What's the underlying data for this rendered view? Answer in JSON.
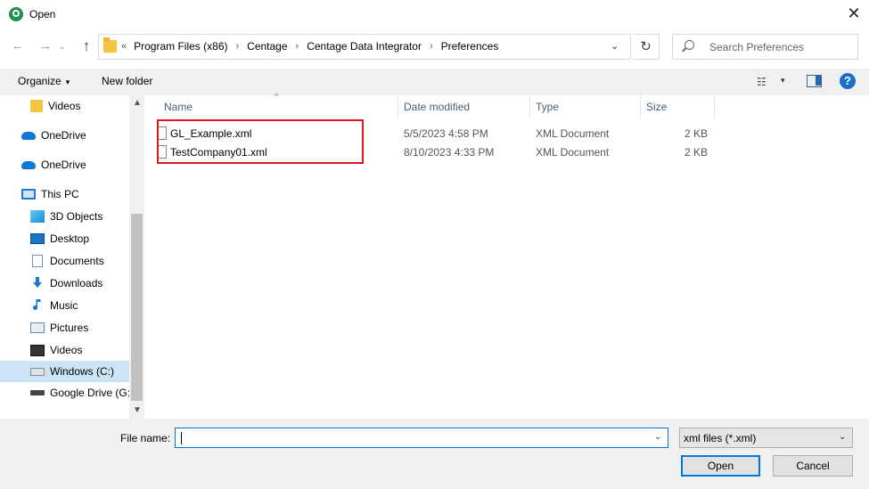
{
  "window": {
    "title": "Open",
    "close_glyph": "✕"
  },
  "nav": {
    "back_glyph": "←",
    "forward_glyph": "→",
    "recent_glyph": "⌄",
    "up_glyph": "↑"
  },
  "address": {
    "prefix": "«",
    "crumbs": [
      "Program Files (x86)",
      "Centage",
      "Centage Data Integrator",
      "Preferences"
    ],
    "separator": "›",
    "dropdown_glyph": "⌄",
    "refresh_glyph": "↻"
  },
  "search": {
    "placeholder": "Search Preferences"
  },
  "toolbar": {
    "organize_label": "Organize",
    "organize_caret": "▾",
    "new_folder_label": "New folder",
    "view_glyph": "☷",
    "view_caret": "▾",
    "help_glyph": "?"
  },
  "sidebar": {
    "scroll_up_glyph": "▲",
    "scroll_down_glyph": "▼",
    "items": [
      {
        "label": "Videos",
        "icon": "folder-icon"
      },
      {
        "label": "OneDrive",
        "icon": "onedrive-icon"
      },
      {
        "label": "OneDrive",
        "icon": "onedrive-icon"
      },
      {
        "label": "This PC",
        "icon": "pc-icon"
      },
      {
        "label": "3D Objects",
        "icon": "3d-objects-icon"
      },
      {
        "label": "Desktop",
        "icon": "desktop-icon"
      },
      {
        "label": "Documents",
        "icon": "documents-icon"
      },
      {
        "label": "Downloads",
        "icon": "downloads-icon"
      },
      {
        "label": "Music",
        "icon": "music-icon"
      },
      {
        "label": "Pictures",
        "icon": "pictures-icon"
      },
      {
        "label": "Videos",
        "icon": "videos-icon"
      },
      {
        "label": "Windows (C:)",
        "icon": "drive-icon"
      },
      {
        "label": "Google Drive (G:",
        "icon": "gdrive-icon"
      }
    ]
  },
  "filelist": {
    "sort_glyph": "^",
    "columns": [
      "Name",
      "Date modified",
      "Type",
      "Size"
    ],
    "rows": [
      {
        "name": "GL_Example.xml",
        "date": "5/5/2023 4:58 PM",
        "type": "XML Document",
        "size": "2 KB"
      },
      {
        "name": "TestCompany01.xml",
        "date": "8/10/2023 4:33 PM",
        "type": "XML Document",
        "size": "2 KB"
      }
    ]
  },
  "footer": {
    "filename_label": "File name:",
    "filename_value": "",
    "dropdown_glyph": "⌄",
    "filetype_value": "xml files (*.xml)",
    "open_label": "Open",
    "cancel_label": "Cancel"
  },
  "colors": {
    "highlight": "#e0141e",
    "accent": "#0078d7",
    "selected_bg": "#cce4f7"
  }
}
